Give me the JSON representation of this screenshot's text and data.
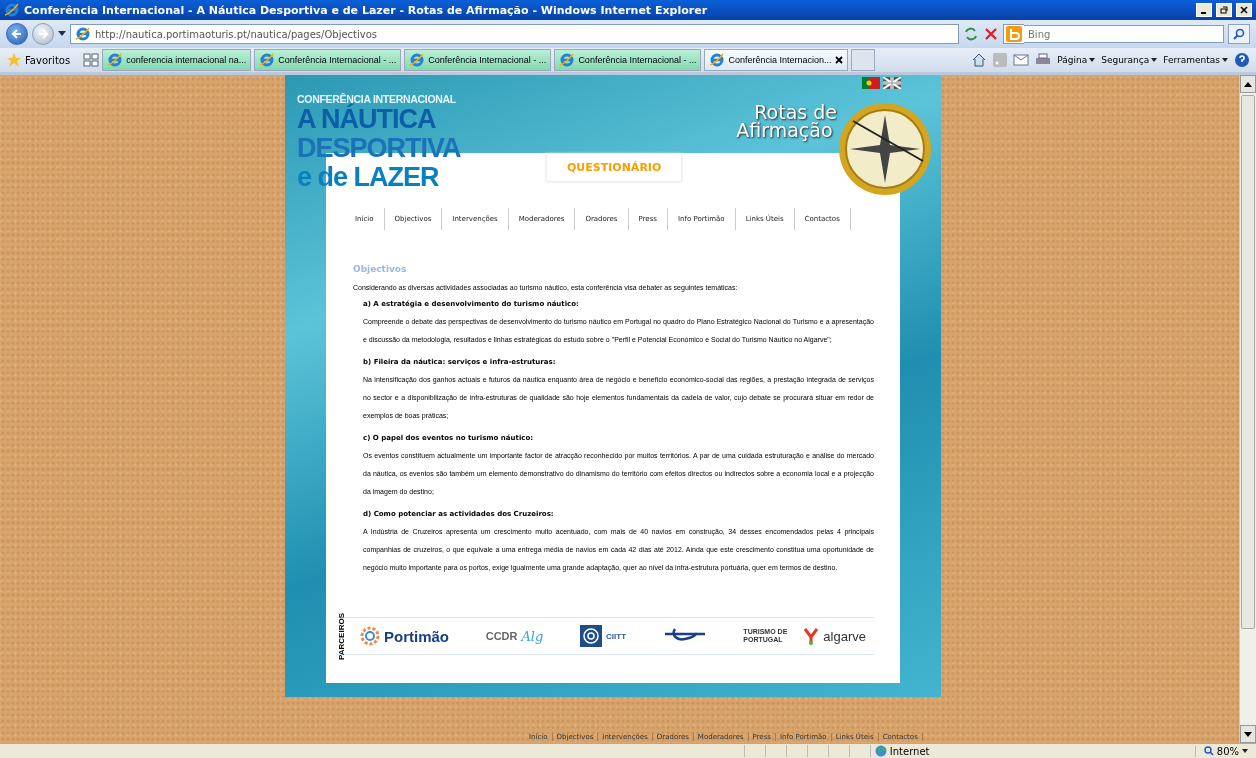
{
  "window": {
    "title": "Conferência Internacional - A Náutica Desportiva e de Lazer - Rotas de Afirmação - Windows Internet Explorer"
  },
  "address_bar": {
    "url": "http://nautica.portimaoturis.pt/nautica/pages/Objectivos",
    "search": {
      "placeholder": "Bing"
    }
  },
  "favorites": {
    "label": "Favoritos"
  },
  "tabs": [
    {
      "label": "conferencia internacional na...",
      "selected": false
    },
    {
      "label": "Conferência Internacional - ...",
      "selected": false
    },
    {
      "label": "Conferência Internacional - ...",
      "selected": false
    },
    {
      "label": "Conferência Internacional - ...",
      "selected": false
    },
    {
      "label": "Conferência Internacion...",
      "selected": true
    }
  ],
  "command_bar": [
    "Página",
    "Segurança",
    "Ferramentas"
  ],
  "page": {
    "logo": {
      "kicker": "CONFERÊNCIA INTERNACIONAL",
      "lines": [
        "A NÁUTICA",
        "DESPORTIVA",
        "e de LAZER"
      ]
    },
    "brand": [
      "Rotas de",
      "Afirmação"
    ],
    "questionnaire": "QUESTIONÁRIO",
    "nav": [
      "Início",
      "Objectivos",
      "Intervenções",
      "Moderadores",
      "Oradores",
      "Press",
      "Info Portimão",
      "Links Úteis",
      "Contactos"
    ],
    "heading": "Objectivos",
    "intro": "Considerando as diversas actividades associadas ao turismo náutico, esta conferência visa debater as seguintes temáticas:",
    "sections": [
      {
        "title": "a) A estratégia e desenvolvimento do turismo náutico:",
        "text": "Compreende o debate das perspectivas de desenvolvimento do turismo náutico em Portugal no quadro do Plano Estratégico Nacional do Turismo e a apresentação e discussão da metodologia, resultados e linhas estratégicas do estudo sobre o \"Perfil e Potencial Económico e Social do Turismo Náutico no Algarve\";"
      },
      {
        "title": "b) Fileira da náutica: serviços e infra-estruturas:",
        "text": "Na intensificação dos ganhos actuais e futuros da náutica enquanto área de negócio e benefício económico-social das regiões, a prestação integrada de serviços no sector e a disponibilização de infra-estruturas de qualidade são hoje elementos fundamentais da cadeia de valor, cujo debate se procurará situar em redor de exemplos de boas práticas;"
      },
      {
        "title": "c) O papel dos eventos no turismo náutico:",
        "text": "Os eventos constituem actualmente um importante factor de atracção reconhecido por muitos territórios. A par de uma cuidada estruturação e análise do mercado da náutica, os eventos são também um elemento demonstrativo do dinamismo do território com efeitos directos ou indirectos sobre a economia local e a projecção da imagem do destino;"
      },
      {
        "title": "d) Como potenciar as actividades dos Cruzeiros:",
        "text": "A Indústria de Cruzeiros apresenta um crescimento muito acentuado, com mais de 40 navios em construção, 34 desses encomendados pelas 4 principais companhias de cruzeiros, o que equivale a uma entrega média de navios em cada 42 dias até 2012. Ainda que este crescimento constitua uma oportunidade de negócio muito importante para os portos, exige igualmente uma grande adaptação, quer ao nível da infra-estrutura portuária, quer em termos de destino."
      }
    ],
    "partners_label": "PARCEIROS",
    "partners": [
      {
        "kind": "portimao",
        "text": "Portimão"
      },
      {
        "kind": "ccdr",
        "text": "CCDR",
        "script": "Alg"
      },
      {
        "kind": "ciitt",
        "text": "CIITT"
      },
      {
        "kind": "iptm"
      },
      {
        "kind": "turismo",
        "caption": "TURISMO DE PORTUGAL",
        "text": "algarve"
      }
    ]
  },
  "footer_links": [
    "Início",
    "Objectivos",
    "Intervenções",
    "Oradores",
    "Moderadores",
    "Press",
    "Info Portimão",
    "Links Úteis",
    "Contactos"
  ],
  "status_bar": {
    "zone": "Internet",
    "zoom": "80%"
  }
}
